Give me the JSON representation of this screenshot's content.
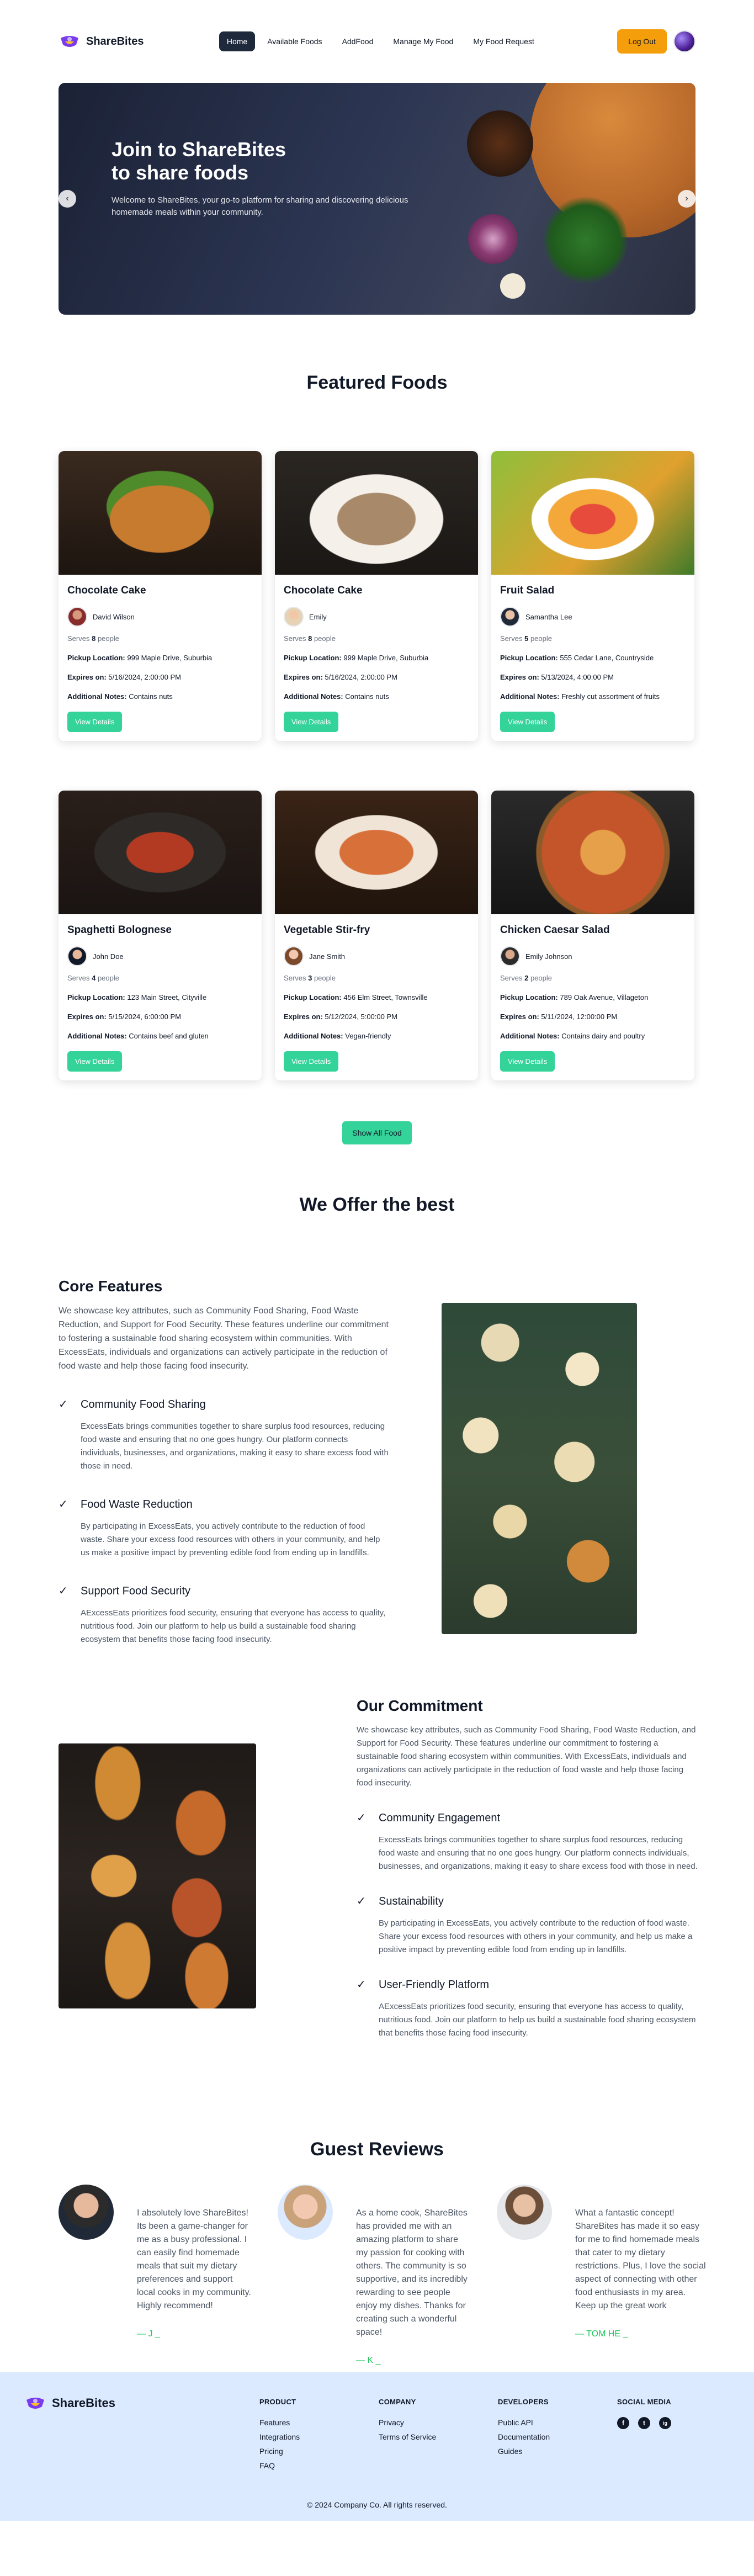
{
  "brand": {
    "name": "ShareBites"
  },
  "nav": {
    "links": [
      {
        "label": "Home"
      },
      {
        "label": "Available Foods"
      },
      {
        "label": "AddFood"
      },
      {
        "label": "Manage My Food"
      },
      {
        "label": "My Food Request"
      }
    ],
    "logout_label": "Log Out"
  },
  "hero": {
    "title_line1": "Join to ShareBites",
    "title_line2": "to share foods",
    "subtitle": "Welcome to ShareBites, your go-to platform for sharing and discovering delicious homemade meals within your community.",
    "prev_icon": "‹",
    "next_icon": "›"
  },
  "featured": {
    "title": "Featured Foods",
    "serves_prefix": "Serves",
    "serves_suffix": "people",
    "pickup_label": "Pickup Location:",
    "expires_label": "Expires on:",
    "notes_label": "Additional Notes:",
    "button_label": "View Details",
    "foods": [
      {
        "name": "Chocolate Cake",
        "donor": "David Wilson",
        "serves": "8",
        "pickup": "999 Maple Drive, Suburbia",
        "expires": "5/16/2024, 2:00:00 PM",
        "notes": "Contains nuts"
      },
      {
        "name": "Chocolate Cake",
        "donor": "Emily",
        "serves": "8",
        "pickup": "999 Maple Drive, Suburbia",
        "expires": "5/16/2024, 2:00:00 PM",
        "notes": "Contains nuts"
      },
      {
        "name": "Fruit Salad",
        "donor": "Samantha Lee",
        "serves": "5",
        "pickup": "555 Cedar Lane, Countryside",
        "expires": "5/13/2024, 4:00:00 PM",
        "notes": "Freshly cut assortment of fruits"
      },
      {
        "name": "Spaghetti Bolognese",
        "donor": "John Doe",
        "serves": "4",
        "pickup": "123 Main Street, Cityville",
        "expires": "5/15/2024, 6:00:00 PM",
        "notes": "Contains beef and gluten"
      },
      {
        "name": "Vegetable Stir-fry",
        "donor": "Jane Smith",
        "serves": "3",
        "pickup": "456 Elm Street, Townsville",
        "expires": "5/12/2024, 5:00:00 PM",
        "notes": "Vegan-friendly"
      },
      {
        "name": "Chicken Caesar Salad",
        "donor": "Emily Johnson",
        "serves": "2",
        "pickup": "789 Oak Avenue, Villageton",
        "expires": "5/11/2024, 12:00:00 PM",
        "notes": "Contains dairy and poultry"
      }
    ],
    "show_all_label": "Show All Food"
  },
  "offer": {
    "title": "We Offer the best",
    "core": {
      "heading": "Core Features",
      "intro": "We showcase key attributes, such as Community Food Sharing, Food Waste Reduction, and Support for Food Security. These features underline our commitment to fostering a sustainable food sharing ecosystem within communities. With ExcessEats, individuals and organizations can actively participate in the reduction of food waste and help those facing food insecurity.",
      "items": [
        {
          "title": "Community Food Sharing",
          "text": "ExcessEats brings communities together to share surplus food resources, reducing food waste and ensuring that no one goes hungry. Our platform connects individuals, businesses, and organizations, making it easy to share excess food with those in need."
        },
        {
          "title": "Food Waste Reduction",
          "text": "By participating in ExcessEats, you actively contribute to the reduction of food waste. Share your excess food resources with others in your community, and help us make a positive impact by preventing edible food from ending up in landfills."
        },
        {
          "title": "Support Food Security",
          "text": "AExcessEats prioritizes food security, ensuring that everyone has access to quality, nutritious food. Join our platform to help us build a sustainable food sharing ecosystem that benefits those facing food insecurity."
        }
      ]
    },
    "commitment": {
      "heading": "Our Commitment",
      "intro": "We showcase key attributes, such as Community Food Sharing, Food Waste Reduction, and Support for Food Security. These features underline our commitment to fostering a sustainable food sharing ecosystem within communities. With ExcessEats, individuals and organizations can actively participate in the reduction of food waste and help those facing food insecurity.",
      "items": [
        {
          "title": "Community Engagement",
          "text": "ExcessEats brings communities together to share surplus food resources, reducing food waste and ensuring that no one goes hungry. Our platform connects individuals, businesses, and organizations, making it easy to share excess food with those in need."
        },
        {
          "title": "Sustainability",
          "text": "By participating in ExcessEats, you actively contribute to the reduction of food waste. Share your excess food resources with others in your community, and help us make a positive impact by preventing edible food from ending up in landfills."
        },
        {
          "title": "User-Friendly Platform",
          "text": "AExcessEats prioritizes food security, ensuring that everyone has access to quality, nutritious food. Join our platform to help us build a sustainable food sharing ecosystem that benefits those facing food insecurity."
        }
      ]
    },
    "check_icon": "✓"
  },
  "reviews": {
    "title": "Guest Reviews",
    "items": [
      {
        "text": "I absolutely love ShareBites! Its been a game-changer for me as a busy professional. I can easily find homemade meals that suit my dietary preferences and support local cooks in my community. Highly recommend!",
        "signature": "— J _"
      },
      {
        "text": "As a home cook, ShareBites has provided me with an amazing platform to share my passion for cooking with others. The community is so supportive, and its incredibly rewarding to see people enjoy my dishes. Thanks for creating such a wonderful space!",
        "signature": "— K _"
      },
      {
        "text": "What a fantastic concept! ShareBites has made it so easy for me to find homemade meals that cater to my dietary restrictions. Plus, I love the social aspect of connecting with other food enthusiasts in my area. Keep up the great work",
        "signature": "— TOM HE _"
      }
    ]
  },
  "footer": {
    "brand": "ShareBites",
    "columns": [
      {
        "title": "PRODUCT",
        "links": [
          "Features",
          "Integrations",
          "Pricing",
          "FAQ"
        ]
      },
      {
        "title": "COMPANY",
        "links": [
          "Privacy",
          "Terms of Service"
        ]
      },
      {
        "title": "DEVELOPERS",
        "links": [
          "Public API",
          "Documentation",
          "Guides"
        ]
      }
    ],
    "social_title": "SOCIAL MEDIA",
    "social_icons": [
      "f",
      "t",
      "ig"
    ],
    "copyright": "© 2024 Company Co. All rights reserved."
  },
  "colors": {
    "accent_green": "#34d399",
    "logout_orange": "#f59e0b",
    "nav_active": "#1e293b",
    "footer_bg": "#dbeafe",
    "signature_green": "#22c55e",
    "brand_purple": "#7c3aed"
  }
}
